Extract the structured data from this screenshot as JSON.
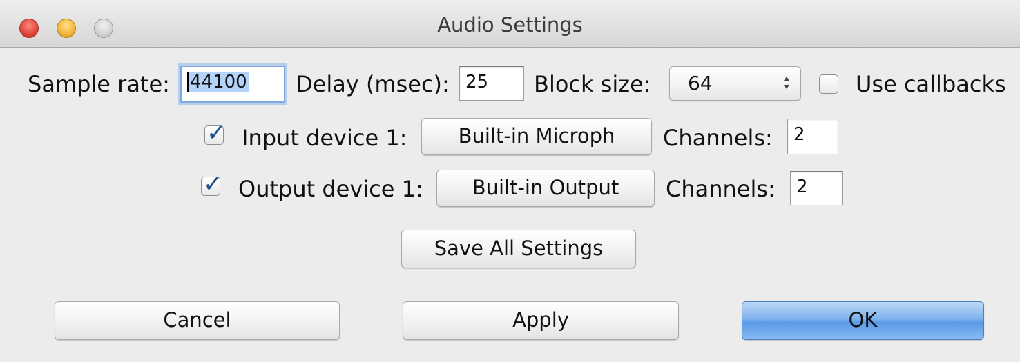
{
  "window": {
    "title": "Audio Settings"
  },
  "row1": {
    "sample_rate_label": "Sample rate:",
    "sample_rate_value": "44100",
    "delay_label": "Delay (msec):",
    "delay_value": "25",
    "block_size_label": "Block size:",
    "block_size_value": "64",
    "use_callbacks_label": "Use callbacks",
    "use_callbacks_checked": false
  },
  "input_device": {
    "checked": true,
    "label": "Input device 1:",
    "device": "Built-in Microph",
    "channels_label": "Channels:",
    "channels_value": "2"
  },
  "output_device": {
    "checked": true,
    "label": "Output device 1:",
    "device": "Built-in Output",
    "channels_label": "Channels:",
    "channels_value": "2"
  },
  "buttons": {
    "save_all": "Save All Settings",
    "cancel": "Cancel",
    "apply": "Apply",
    "ok": "OK"
  },
  "icons": {
    "checkmark": "checkmark-icon",
    "stepper": "updown-arrows-icon"
  },
  "colors": {
    "default_button": "#6aa6ec",
    "focus_ring": "#7fa8de",
    "checkmark": "#1f4f8a"
  }
}
